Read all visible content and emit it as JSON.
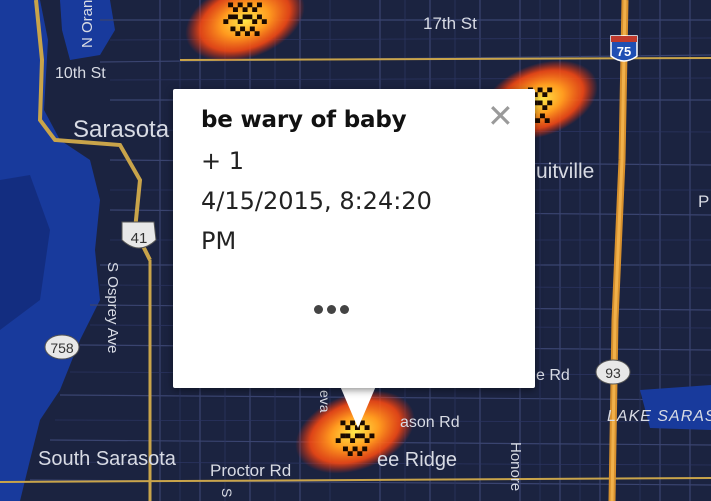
{
  "map": {
    "labels": {
      "street_17th": "17th St",
      "street_10th": "10th St",
      "street_n_orange": "N Orange",
      "city_sarasota": "Sarasota",
      "city_fruitville": "uitville",
      "street_s_osprey": "S Osprey Ave",
      "street_proctor": "Proctor Rd",
      "city_south_sarasota": "South Sarasota",
      "city_ridge": "ee Ridge",
      "street_bason": "ason Rd",
      "street_honore": "Honore",
      "street_e_rd": "e Rd",
      "lake_sarasota": "LAKE SARAS",
      "street_p": "P",
      "street_eva": "eva",
      "street_s": "S"
    },
    "shields": {
      "i75": "75",
      "us41": "41",
      "sr758": "758",
      "sr93": "93"
    },
    "colors": {
      "water": "#183a9c",
      "land": "#1b2340",
      "major_road": "#c9a44a",
      "street": "#3a4470",
      "label": "#d8dbe4"
    }
  },
  "popup": {
    "title": "be wary of baby",
    "votes": "+ 1",
    "timestamp_line1": "4/15/2015, 8:24:20",
    "timestamp_line2": "PM"
  },
  "icons": {
    "close": "close-icon",
    "more": "more-dots-icon"
  }
}
